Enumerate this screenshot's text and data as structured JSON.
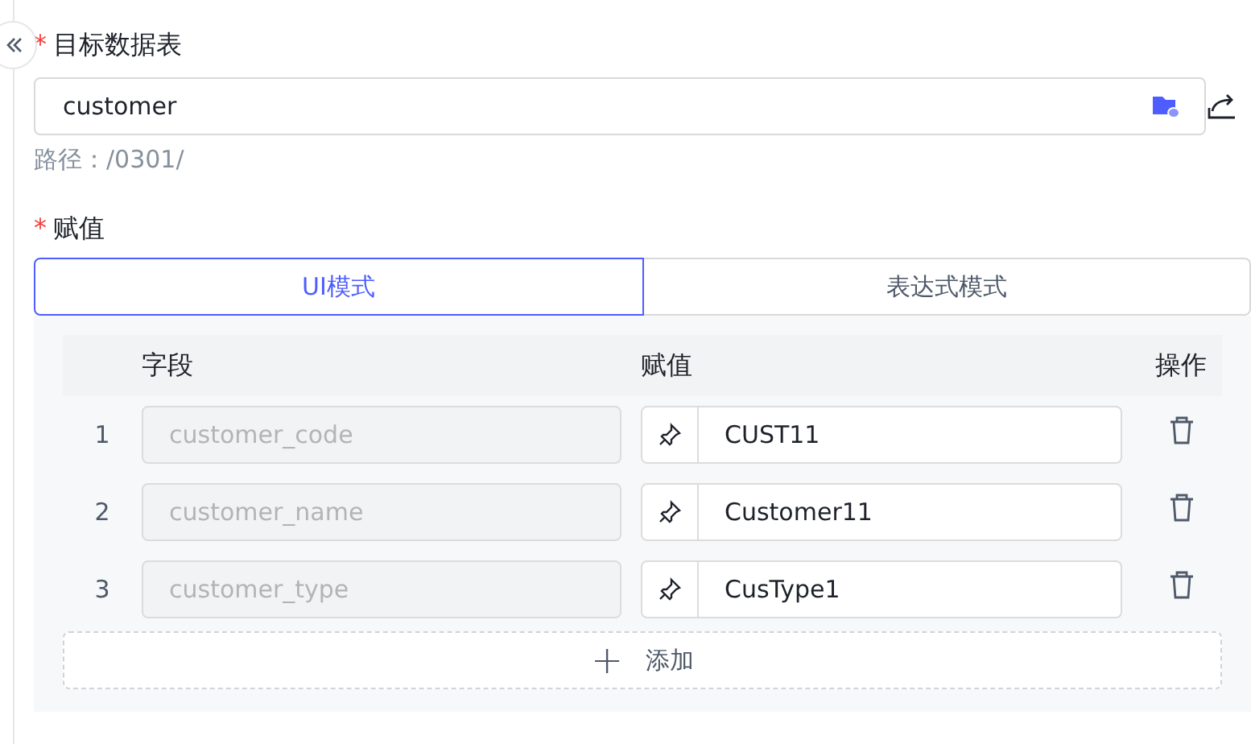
{
  "target_table": {
    "label": "目标数据表",
    "required_mark": "*",
    "value": "customer",
    "path": "路径：/0301/"
  },
  "assignment": {
    "label": "赋值",
    "required_mark": "*",
    "modes": [
      {
        "label": "UI模式",
        "selected": true
      },
      {
        "label": "表达式模式",
        "selected": false
      }
    ],
    "columns": [
      "字段",
      "赋值",
      "操作"
    ],
    "rows": [
      {
        "index": "1",
        "field": "customer_code",
        "field_disabled": true,
        "value": "CUST11"
      },
      {
        "index": "2",
        "field": "customer_name",
        "field_disabled": true,
        "value": "Customer11"
      },
      {
        "index": "3",
        "field": "customer_type",
        "field_disabled": true,
        "value": "CusType1"
      }
    ],
    "add_button": {
      "icon": "+",
      "label": "添加"
    }
  }
}
